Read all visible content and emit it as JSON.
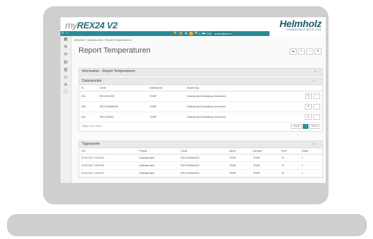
{
  "brand": {
    "my": "my",
    "rex": "REX24",
    "version": "V2",
    "company": "Helmholz",
    "tagline": "COMPATIBLE WITH YOU"
  },
  "topbar": {
    "menu_icon": "≡",
    "home_icon": "⌂",
    "badge1": "3",
    "badge2": "2",
    "mail_count": "1",
    "msg_count": "134",
    "user": "admin@dmt ▾"
  },
  "breadcrumb": "Berichte  ›  Datenpunkte  ›  Report Temperaturen",
  "page_title": "Report Temperaturen",
  "info_panel": {
    "title": "Information - Report Temperaturen"
  },
  "datapoints": {
    "title": "Datenpunkte",
    "columns": [
      "ID",
      "Gerät",
      "Datenpunkt",
      "Skalierung"
    ],
    "rows": [
      {
        "id": "224",
        "device": "REX100LISE",
        "dp": "TEMP",
        "scaling": "Datenpunkt-Einstellung verwenden"
      },
      {
        "id": "258",
        "device": "REX100WANCB",
        "dp": "TEMP",
        "scaling": "Datenpunkt-Einstellung verwenden"
      },
      {
        "id": "204",
        "device": "REX100M12",
        "dp": "TEMP",
        "scaling": "Datenpunkt-Einstellung verwenden"
      }
    ],
    "pager_text": "Zeige 1 bis 3 von 3",
    "prev": "Vorher",
    "page": "1",
    "next": "Weiter"
  },
  "daily": {
    "title": "Tageswerte",
    "columns": [
      "Zeit",
      "Projekt",
      "Gerät",
      "Name",
      "Adresse",
      "Wert",
      "Gültig"
    ],
    "rows": [
      {
        "time": "23.05.2017 16:53:01",
        "project": "Arbeitsprojekt",
        "device": "REX100WANCB",
        "name": "TEMP",
        "addr": "TEMP",
        "value": "75",
        "valid": "1"
      },
      {
        "time": "23.05.2017 16:52:59",
        "project": "Arbeitsprojekt",
        "device": "REX100WANCB",
        "name": "TEMP",
        "addr": "TEMP",
        "value": "74",
        "valid": "1"
      },
      {
        "time": "23.05.2017 16:52:57",
        "project": "Arbeitsprojekt",
        "device": "REX100WANCB",
        "name": "TEMP",
        "addr": "TEMP",
        "value": "75",
        "valid": "1"
      }
    ]
  },
  "colors": {
    "accent": "#2a8a95",
    "brand": "#1f5866"
  }
}
